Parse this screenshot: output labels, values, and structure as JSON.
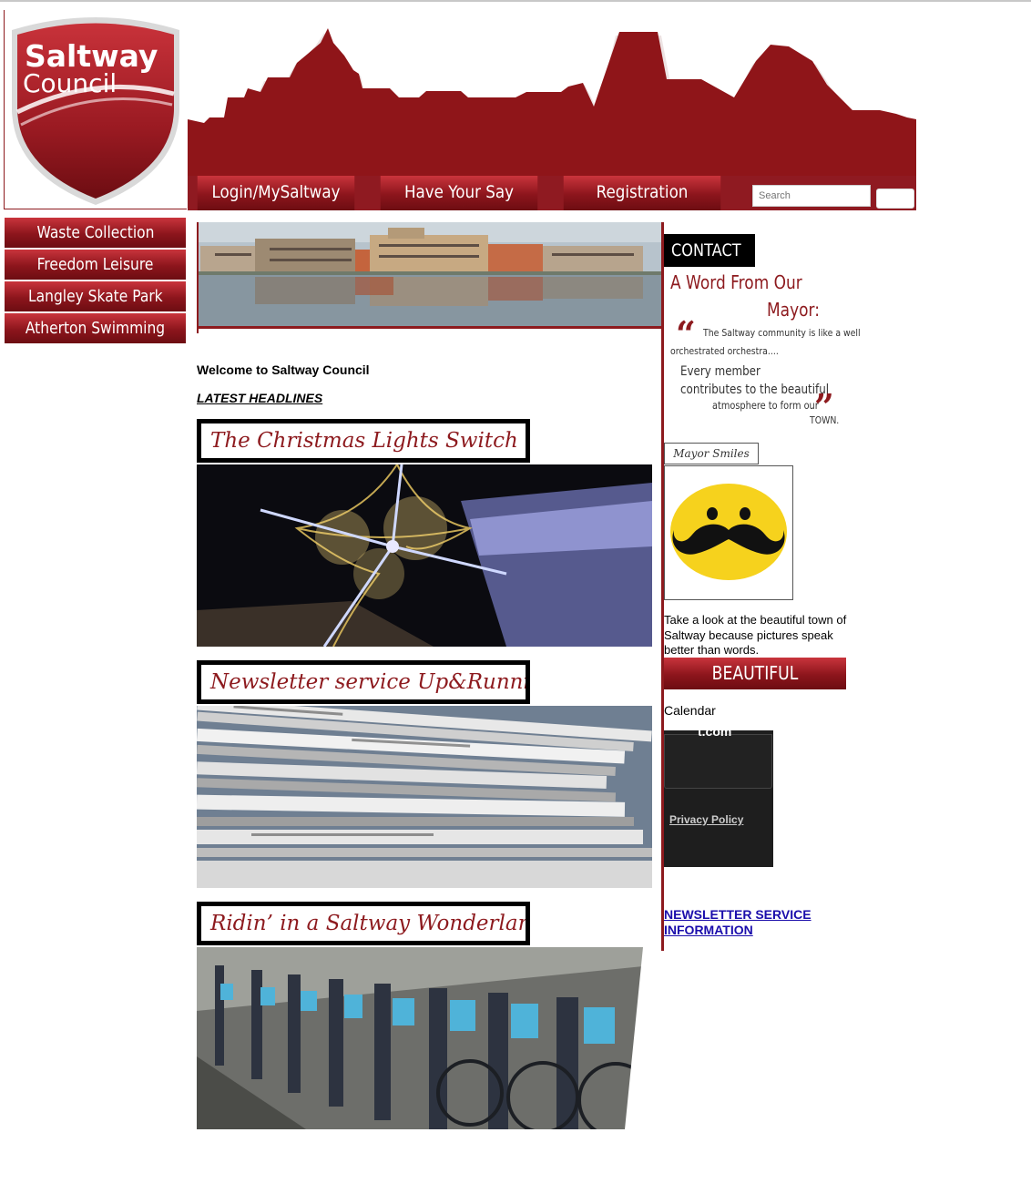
{
  "header": {
    "logo_line1": "Saltway",
    "logo_line2": "Council"
  },
  "nav": {
    "items": [
      "Login/MySaltway",
      "Have Your Say",
      "Registration"
    ]
  },
  "search": {
    "placeholder": "Search"
  },
  "sidebar": {
    "items": [
      "Waste Collection",
      "Freedom Leisure Centre",
      "Langley Skate Park",
      "Atherton Swimming Pool"
    ]
  },
  "main": {
    "welcome": "Welcome to Saltway Council",
    "latest_label": "LATEST HEADLINES",
    "headlines": [
      "The Christmas Lights Switch On!",
      "Newsletter service Up&Running",
      "Ridin’ in a Saltway Wonderland"
    ]
  },
  "right": {
    "contact_label": "CONTACT US",
    "mayor_heading_1": "A Word From Our",
    "mayor_heading_2": "Mayor:",
    "quote_line1": "The Saltway community is like a well",
    "quote_line2": "orchestrated orchestra....",
    "quote_line3": "Every member",
    "quote_line4": "contributes to the beautiful",
    "quote_line5": "atmosphere to form our",
    "quote_line6": "TOWN.",
    "smiles_label": "Mayor Smiles",
    "lookat_text": "Take a look at the beautiful town of Saltway because pictures speak better than words.",
    "beautiful_label": "BEAUTIFUL SALTWAY",
    "calendar_label": "Calendar",
    "calendar_top_text": "t.com",
    "privacy_label": "Privacy Policy",
    "newsletter_link": "NEWSLETTER SERVICE INFORMATION"
  },
  "colors": {
    "brand_red": "#8d1a1e",
    "link_blue": "#1a0dab"
  }
}
